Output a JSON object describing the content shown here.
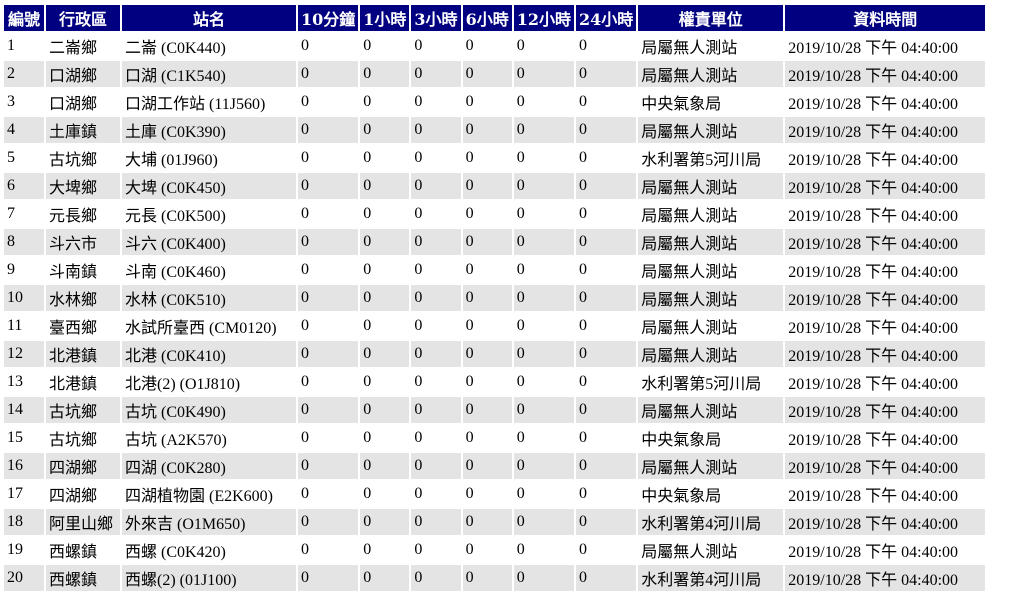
{
  "colors": {
    "header_bg": "#000080",
    "header_text": "#ffffff",
    "row_alt": "#e4e4e4"
  },
  "table": {
    "headers": [
      "編號",
      "行政區",
      "站名",
      "10分鐘",
      "1小時",
      "3小時",
      "6小時",
      "12小時",
      "24小時",
      "權責單位",
      "資料時間"
    ],
    "rows": [
      [
        "1",
        "二崙鄉",
        "二崙 (C0K440)",
        "0",
        "0",
        "0",
        "0",
        "0",
        "0",
        "局屬無人測站",
        "2019/10/28 下午 04:40:00"
      ],
      [
        "2",
        "口湖鄉",
        "口湖 (C1K540)",
        "0",
        "0",
        "0",
        "0",
        "0",
        "0",
        "局屬無人測站",
        "2019/10/28 下午 04:40:00"
      ],
      [
        "3",
        "口湖鄉",
        "口湖工作站 (11J560)",
        "0",
        "0",
        "0",
        "0",
        "0",
        "0",
        "中央氣象局",
        "2019/10/28 下午 04:40:00"
      ],
      [
        "4",
        "土庫鎮",
        "土庫 (C0K390)",
        "0",
        "0",
        "0",
        "0",
        "0",
        "0",
        "局屬無人測站",
        "2019/10/28 下午 04:40:00"
      ],
      [
        "5",
        "古坑鄉",
        "大埔 (01J960)",
        "0",
        "0",
        "0",
        "0",
        "0",
        "0",
        "水利署第5河川局",
        "2019/10/28 下午 04:40:00"
      ],
      [
        "6",
        "大埤鄉",
        "大埤 (C0K450)",
        "0",
        "0",
        "0",
        "0",
        "0",
        "0",
        "局屬無人測站",
        "2019/10/28 下午 04:40:00"
      ],
      [
        "7",
        "元長鄉",
        "元長 (C0K500)",
        "0",
        "0",
        "0",
        "0",
        "0",
        "0",
        "局屬無人測站",
        "2019/10/28 下午 04:40:00"
      ],
      [
        "8",
        "斗六市",
        "斗六 (C0K400)",
        "0",
        "0",
        "0",
        "0",
        "0",
        "0",
        "局屬無人測站",
        "2019/10/28 下午 04:40:00"
      ],
      [
        "9",
        "斗南鎮",
        "斗南 (C0K460)",
        "0",
        "0",
        "0",
        "0",
        "0",
        "0",
        "局屬無人測站",
        "2019/10/28 下午 04:40:00"
      ],
      [
        "10",
        "水林鄉",
        "水林 (C0K510)",
        "0",
        "0",
        "0",
        "0",
        "0",
        "0",
        "局屬無人測站",
        "2019/10/28 下午 04:40:00"
      ],
      [
        "11",
        "臺西鄉",
        "水試所臺西 (CM0120)",
        "0",
        "0",
        "0",
        "0",
        "0",
        "0",
        "局屬無人測站",
        "2019/10/28 下午 04:40:00"
      ],
      [
        "12",
        "北港鎮",
        "北港 (C0K410)",
        "0",
        "0",
        "0",
        "0",
        "0",
        "0",
        "局屬無人測站",
        "2019/10/28 下午 04:40:00"
      ],
      [
        "13",
        "北港鎮",
        "北港(2) (O1J810)",
        "0",
        "0",
        "0",
        "0",
        "0",
        "0",
        "水利署第5河川局",
        "2019/10/28 下午 04:40:00"
      ],
      [
        "14",
        "古坑鄉",
        "古坑 (C0K490)",
        "0",
        "0",
        "0",
        "0",
        "0",
        "0",
        "局屬無人測站",
        "2019/10/28 下午 04:40:00"
      ],
      [
        "15",
        "古坑鄉",
        "古坑 (A2K570)",
        "0",
        "0",
        "0",
        "0",
        "0",
        "0",
        "中央氣象局",
        "2019/10/28 下午 04:40:00"
      ],
      [
        "16",
        "四湖鄉",
        "四湖 (C0K280)",
        "0",
        "0",
        "0",
        "0",
        "0",
        "0",
        "局屬無人測站",
        "2019/10/28 下午 04:40:00"
      ],
      [
        "17",
        "四湖鄉",
        "四湖植物園 (E2K600)",
        "0",
        "0",
        "0",
        "0",
        "0",
        "0",
        "中央氣象局",
        "2019/10/28 下午 04:40:00"
      ],
      [
        "18",
        "阿里山鄉",
        "外來吉 (O1M650)",
        "0",
        "0",
        "0",
        "0",
        "0",
        "0",
        "水利署第4河川局",
        "2019/10/28 下午 04:40:00"
      ],
      [
        "19",
        "西螺鎮",
        "西螺 (C0K420)",
        "0",
        "0",
        "0",
        "0",
        "0",
        "0",
        "局屬無人測站",
        "2019/10/28 下午 04:40:00"
      ],
      [
        "20",
        "西螺鎮",
        "西螺(2) (01J100)",
        "0",
        "0",
        "0",
        "0",
        "0",
        "0",
        "水利署第4河川局",
        "2019/10/28 下午 04:40:00"
      ]
    ]
  }
}
